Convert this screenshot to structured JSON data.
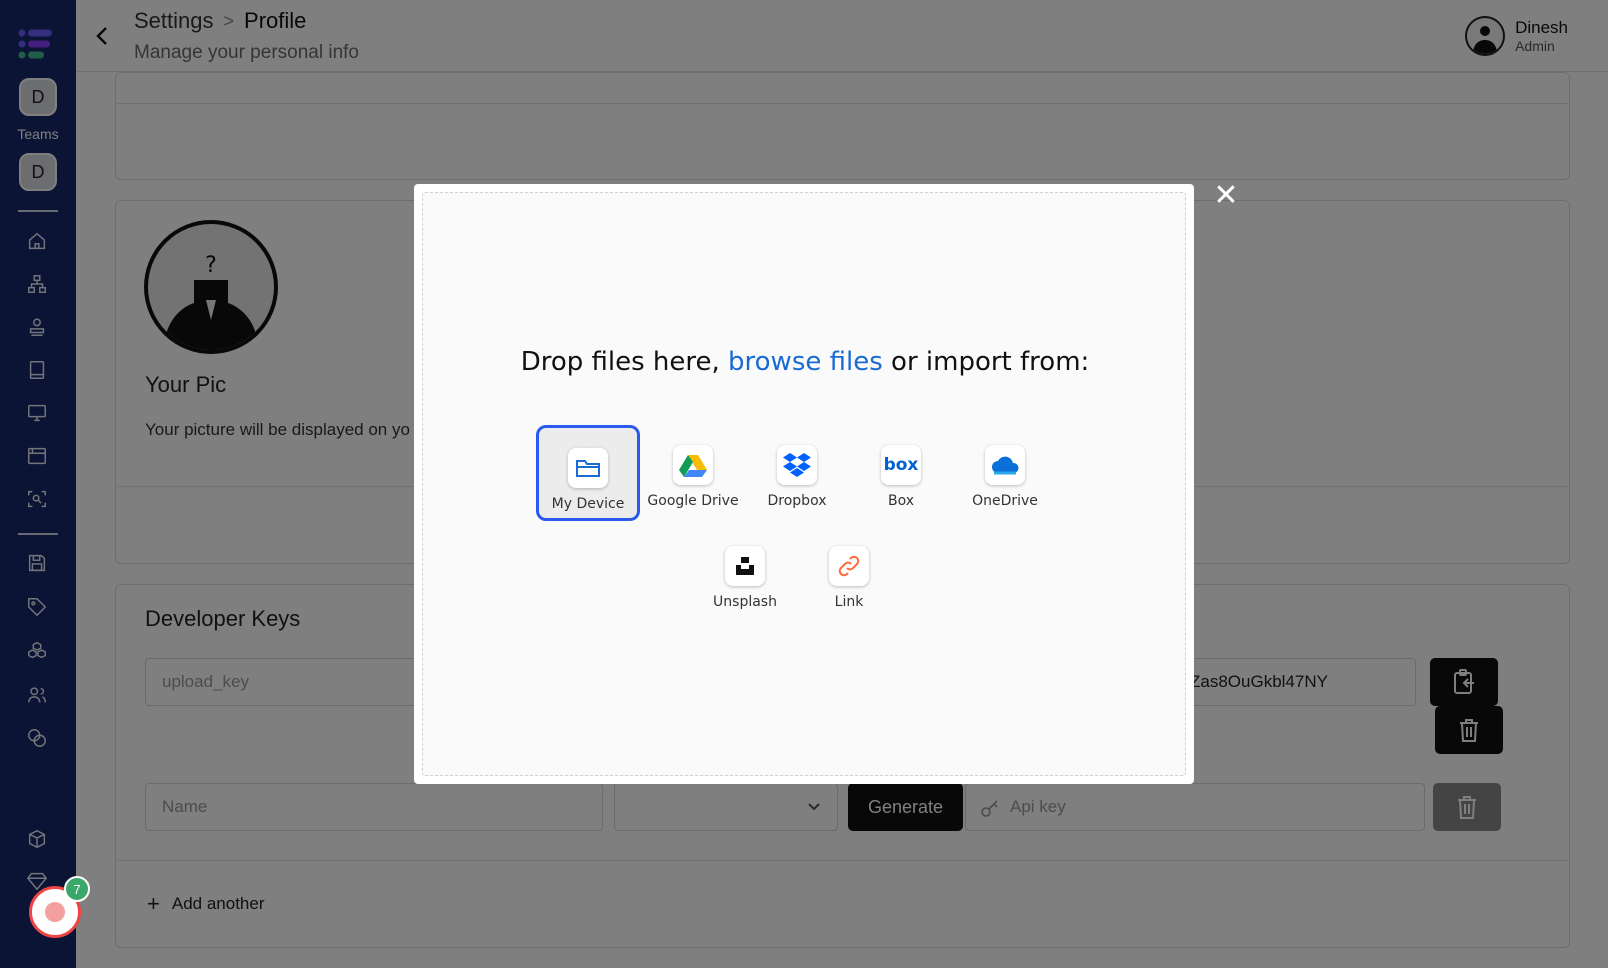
{
  "sidebar": {
    "team_initial_1": "D",
    "teams_label": "Teams",
    "team_initial_2": "D"
  },
  "header": {
    "breadcrumb_parent": "Settings",
    "breadcrumb_separator": ">",
    "breadcrumb_current": "Profile",
    "subtitle": "Manage your personal info",
    "user_name": "Dinesh",
    "user_role": "Admin"
  },
  "profile": {
    "pic_title": "Your Pic",
    "pic_description": "Your picture will be displayed on yo"
  },
  "developer_keys": {
    "title": "Developer Keys",
    "row1_name": "upload_key",
    "row1_key": "Zas8OuGkbl47NY",
    "name_placeholder": "Name",
    "generate_label": "Generate",
    "api_key_placeholder": "Api key",
    "add_another_label": "Add another"
  },
  "modal": {
    "title_before": "Drop files here, ",
    "title_link": "browse files",
    "title_after": " or import from:",
    "sources": [
      {
        "label": "My Device",
        "icon": "folder-icon"
      },
      {
        "label": "Google Drive",
        "icon": "google-drive-icon"
      },
      {
        "label": "Dropbox",
        "icon": "dropbox-icon"
      },
      {
        "label": "Box",
        "icon": "box-icon"
      },
      {
        "label": "OneDrive",
        "icon": "onedrive-icon"
      },
      {
        "label": "Unsplash",
        "icon": "unsplash-icon"
      },
      {
        "label": "Link",
        "icon": "link-icon"
      }
    ],
    "close_symbol": "✕"
  },
  "notification_count": "7",
  "colors": {
    "sidebar": "#16296a",
    "link": "#1a6bd1",
    "selected_border": "#2a5bf0",
    "badge": "#3aa86b"
  }
}
